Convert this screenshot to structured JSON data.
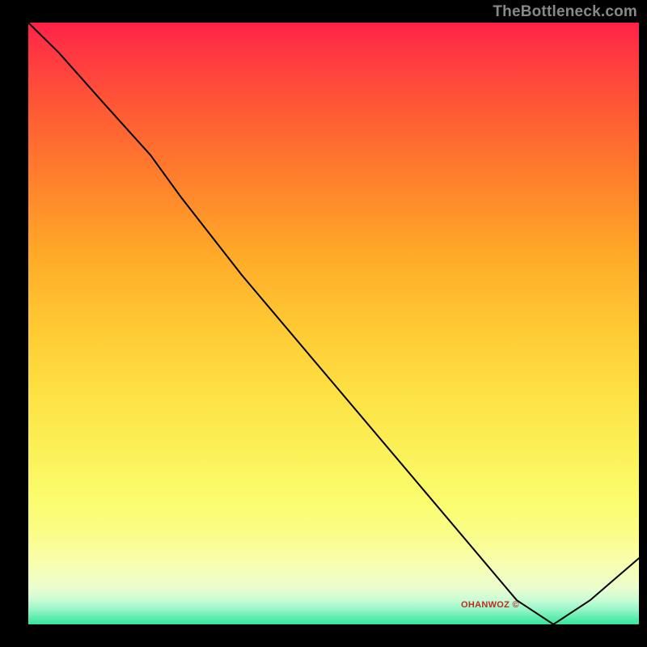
{
  "watermark": "TheBottleneck.com",
  "annotation": "OHANWOZ ©",
  "colors": {
    "curve": "#000000",
    "background": "#000000",
    "watermark": "#888888",
    "annotation": "#c02b20"
  },
  "chart_data": {
    "type": "line",
    "title": "",
    "xlabel": "",
    "ylabel": "",
    "xlim": [
      0,
      100
    ],
    "ylim": [
      0,
      100
    ],
    "grid": false,
    "series": [
      {
        "name": "curve",
        "x": [
          0,
          5,
          12,
          20,
          25,
          35,
          50,
          65,
          80,
          86,
          92,
          100
        ],
        "values": [
          100,
          95,
          87,
          78,
          71,
          58,
          40,
          22,
          4,
          0,
          4,
          11
        ]
      }
    ]
  }
}
